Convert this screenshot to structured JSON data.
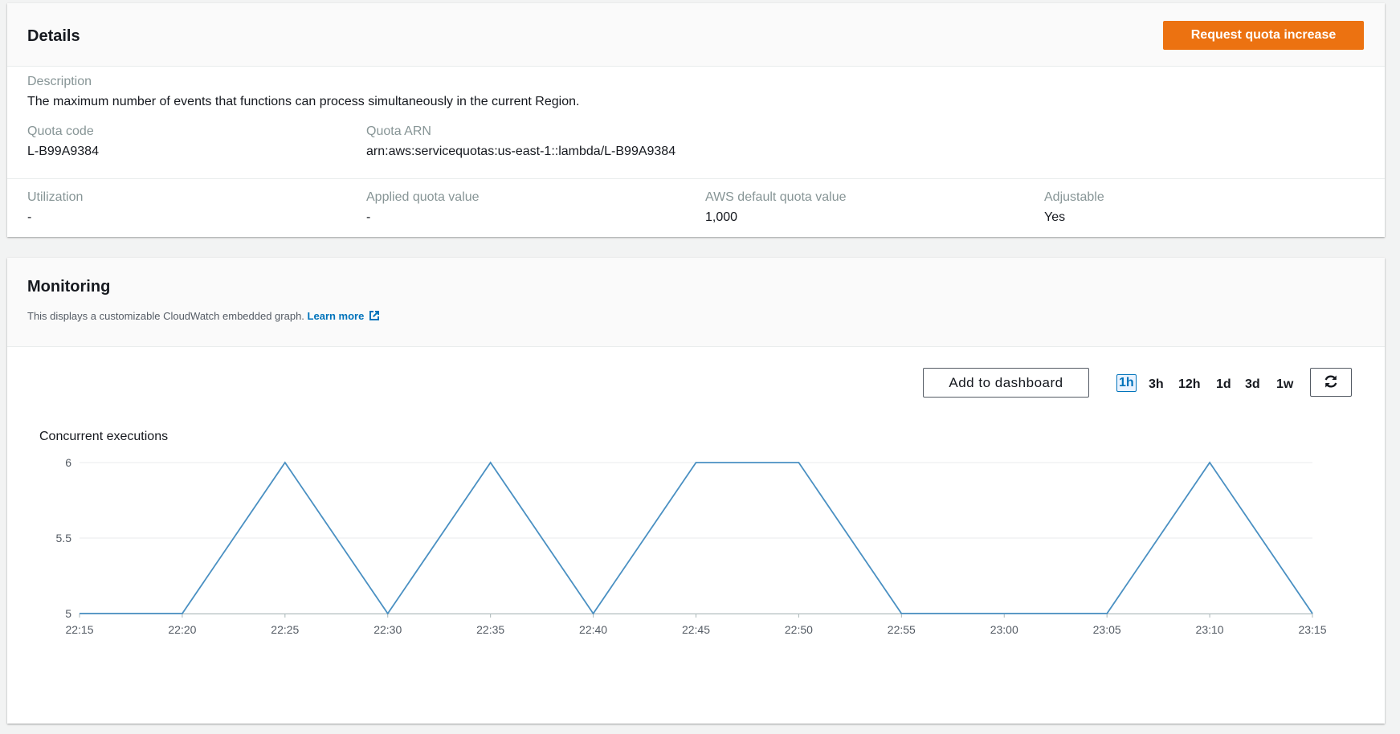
{
  "details": {
    "title": "Details",
    "request_button": "Request quota increase",
    "description_label": "Description",
    "description": "The maximum number of events that functions can process simultaneously in the current Region.",
    "quota_code_label": "Quota code",
    "quota_code": "L-B99A9384",
    "quota_arn_label": "Quota ARN",
    "quota_arn": "arn:aws:servicequotas:us-east-1::lambda/L-B99A9384",
    "utilization_label": "Utilization",
    "utilization": "-",
    "applied_label": "Applied quota value",
    "applied": "-",
    "default_label": "AWS default quota value",
    "default": "1,000",
    "adjustable_label": "Adjustable",
    "adjustable": "Yes"
  },
  "monitoring": {
    "title": "Monitoring",
    "subtitle": "This displays a customizable CloudWatch embedded graph.",
    "learn_more": "Learn more",
    "add_dashboard": "Add to dashboard",
    "ranges": [
      "1h",
      "3h",
      "12h",
      "1d",
      "3d",
      "1w"
    ],
    "active_range": "1h",
    "refresh_icon": "refresh-icon",
    "external_icon": "external-link-icon"
  },
  "colors": {
    "primary_button": "#ec7211",
    "link": "#0073bb",
    "line": "#4a90c2"
  },
  "chart_data": {
    "type": "line",
    "title": "Concurrent executions",
    "x": [
      "22:15",
      "22:20",
      "22:25",
      "22:30",
      "22:35",
      "22:40",
      "22:45",
      "22:50",
      "22:55",
      "23:00",
      "23:05",
      "23:10",
      "23:15"
    ],
    "series": [
      {
        "values": [
          5,
          5,
          6,
          5,
          6,
          5,
          6,
          6,
          5,
          5,
          5,
          6,
          5
        ]
      }
    ],
    "y_ticks": [
      5,
      5.5,
      6
    ],
    "y_tick_labels": [
      "5",
      "5.5",
      "6"
    ],
    "ylim": [
      5,
      6
    ],
    "grid": true,
    "legend": "none"
  }
}
